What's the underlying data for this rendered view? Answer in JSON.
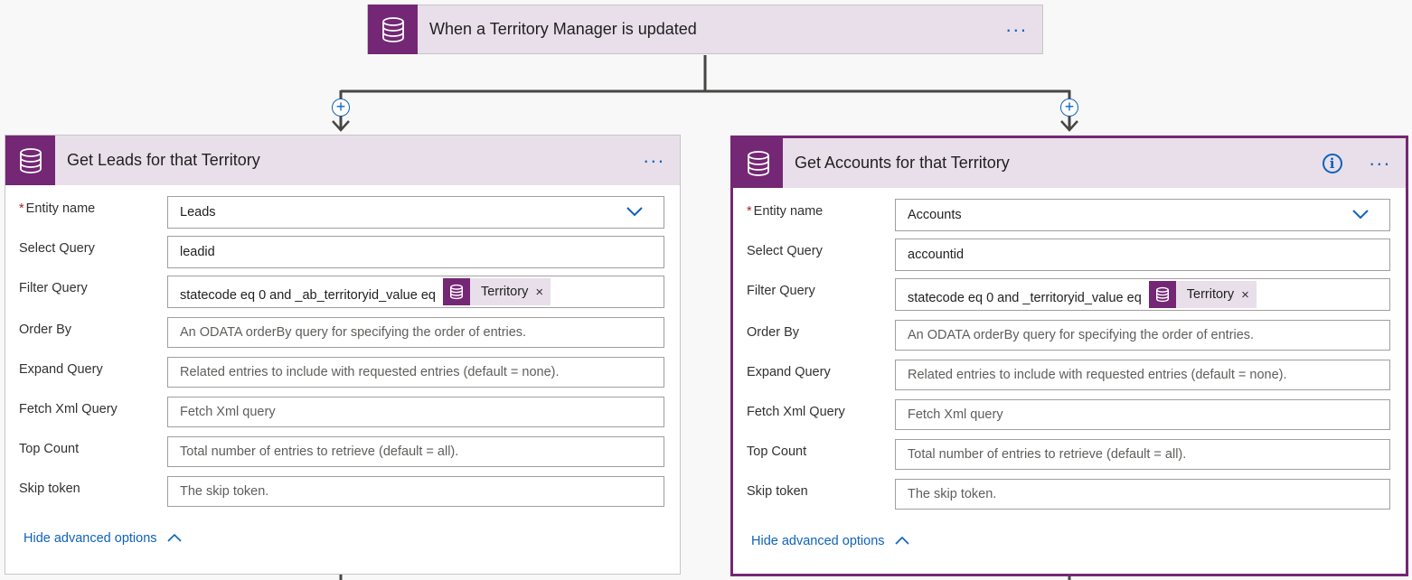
{
  "trigger": {
    "title": "When a Territory Manager is updated",
    "more_icon": "more-ellipsis-icon"
  },
  "left_card": {
    "title": "Get Leads for that Territory",
    "fields": {
      "entity_name": {
        "label": "Entity name",
        "value": "Leads"
      },
      "select_query": {
        "label": "Select Query",
        "value": "leadid"
      },
      "filter_query": {
        "label": "Filter Query",
        "value": "statecode eq 0 and  _ab_territoryid_value eq",
        "token": "Territory"
      },
      "order_by": {
        "label": "Order By",
        "placeholder": "An ODATA orderBy query for specifying the order of entries."
      },
      "expand_query": {
        "label": "Expand Query",
        "placeholder": "Related entries to include with requested entries (default = none)."
      },
      "fetch_xml": {
        "label": "Fetch Xml Query",
        "placeholder": "Fetch Xml query"
      },
      "top_count": {
        "label": "Top Count",
        "placeholder": "Total number of entries to retrieve (default = all)."
      },
      "skip_token": {
        "label": "Skip token",
        "placeholder": "The skip token."
      }
    },
    "hide_advanced": "Hide advanced options"
  },
  "right_card": {
    "title": "Get Accounts for that Territory",
    "fields": {
      "entity_name": {
        "label": "Entity name",
        "value": "Accounts"
      },
      "select_query": {
        "label": "Select Query",
        "value": "accountid"
      },
      "filter_query": {
        "label": "Filter Query",
        "value": "statecode eq 0 and  _territoryid_value eq",
        "token": "Territory"
      },
      "order_by": {
        "label": "Order By",
        "placeholder": "An ODATA orderBy query for specifying the order of entries."
      },
      "expand_query": {
        "label": "Expand Query",
        "placeholder": "Related entries to include with requested entries (default = none)."
      },
      "fetch_xml": {
        "label": "Fetch Xml Query",
        "placeholder": "Fetch Xml query"
      },
      "top_count": {
        "label": "Top Count",
        "placeholder": "Total number of entries to retrieve (default = all)."
      },
      "skip_token": {
        "label": "Skip token",
        "placeholder": "The skip token."
      }
    },
    "hide_advanced": "Hide advanced options"
  },
  "colors": {
    "brand_purple": "#742774",
    "header_bg": "#e8dfeb",
    "link_blue": "#0f62ba",
    "required_red": "#a4262c"
  }
}
